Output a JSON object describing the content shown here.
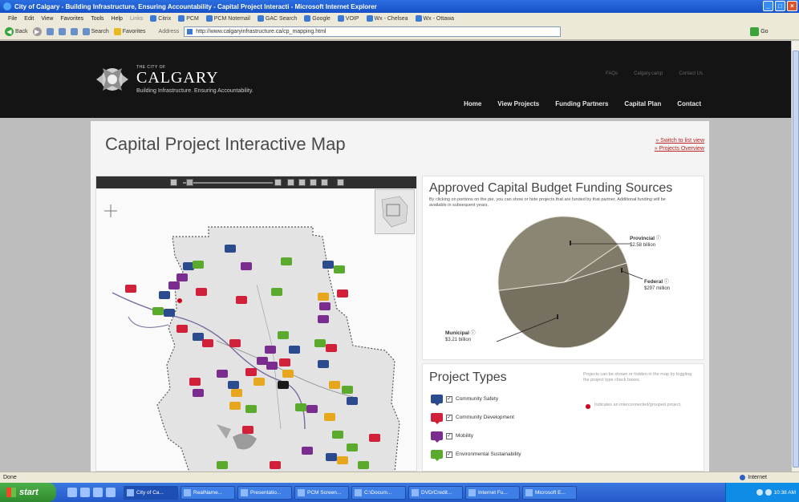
{
  "window": {
    "title": "City of Calgary - Building Infrastructure, Ensuring Accountability - Capital Project Interacti - Microsoft Internet Explorer"
  },
  "menu": {
    "items": [
      "File",
      "Edit",
      "View",
      "Favorites",
      "Tools",
      "Help"
    ],
    "links": [
      "Links",
      "Citrix",
      "PCM",
      "PCM Notemail",
      "GAC Search",
      "Google",
      "VOIP",
      "Wx - Chelsea",
      "Wx - Ottawa"
    ]
  },
  "toolbar": {
    "back": "Back",
    "search": "Search",
    "favorites": "Favorites",
    "address_label": "Address",
    "url": "http://www.calgaryinfrastructure.ca/cp_mapping.html",
    "go": "Go"
  },
  "site": {
    "logo_small": "THE CITY OF",
    "logo_big": "CALGARY",
    "tagline": "Building Infrastructure. Ensuring Accountability.",
    "top_links": [
      "FAQs",
      "Calgary.ca/cp",
      "Contact Us"
    ],
    "nav": [
      "Home",
      "View Projects",
      "Funding Partners",
      "Capital Plan",
      "Contact"
    ]
  },
  "page": {
    "title": "Capital Project Interactive Map",
    "link_list": "» Switch to list view",
    "link_overview": "» Projects Overview"
  },
  "budget": {
    "title": "Approved Capital Budget Funding Sources",
    "description": "By clicking on portions on the pie, you can show or hide projects that are funded by that partner. Additional funding will be available in subsequent years.",
    "provincial_label": "Provincial",
    "provincial_value": "$2.58 billion",
    "federal_label": "Federal",
    "federal_value": "$297 million",
    "municipal_label": "Municipal",
    "municipal_value": "$3.21 billion",
    "info_glyph": "ⓘ",
    "colors": {
      "pie": "#7d7768",
      "pie_upper": "#8c8676"
    }
  },
  "chart_data": {
    "type": "pie",
    "categories": [
      "Provincial",
      "Federal",
      "Municipal"
    ],
    "values": [
      2.58,
      0.297,
      3.21
    ],
    "units": "billion $",
    "title": "Approved Capital Budget Funding Sources"
  },
  "types": {
    "title": "Project Types",
    "items": [
      {
        "label": "Community Safety",
        "color": "#2c4a8e"
      },
      {
        "label": "Community Development",
        "color": "#d0203a"
      },
      {
        "label": "Mobility",
        "color": "#7a2d8f"
      },
      {
        "label": "Environmental Sustainability",
        "color": "#5aaa2e"
      }
    ],
    "note": "Projects can be shown or hidden in the map by toggling the project type check boxes.",
    "note2": "Indicates an interconnected/grouped project.",
    "check": "✓"
  },
  "status": {
    "left": "Done",
    "zone": "Internet"
  },
  "taskbar": {
    "start": "start",
    "tasks": [
      "City of Ca...",
      "RealName...",
      "Presentatio...",
      "PCM Screen...",
      "C:\\Docum...",
      "DVD/Credit...",
      "Internet Fu...",
      "Microsoft E..."
    ],
    "clock": "10:38 AM"
  }
}
